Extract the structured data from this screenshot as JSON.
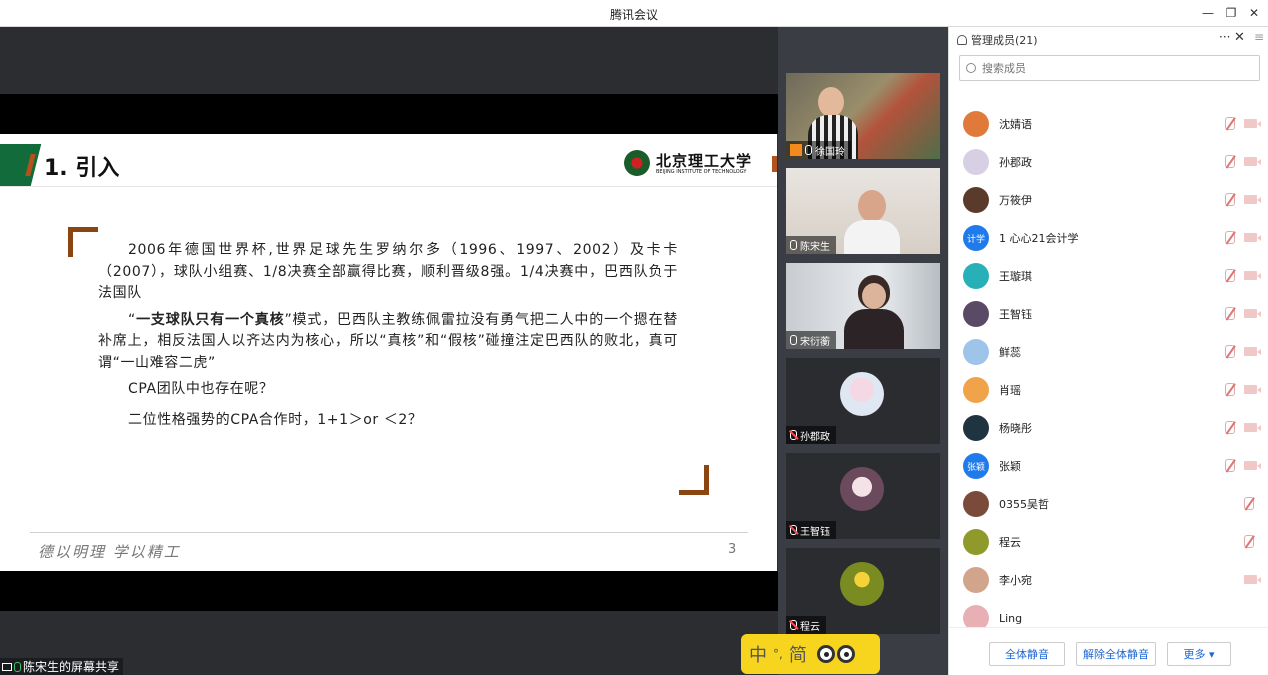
{
  "window": {
    "title": "腾讯会议"
  },
  "slide": {
    "heading": "1. 引入",
    "logo_cn": "北京理工大学",
    "logo_en": "BEIJING INSTITUTE OF TECHNOLOGY",
    "paragraph1": "2006年德国世界杯,世界足球先生罗纳尔多（1996、1997、2002）及卡卡（2007），球队小组赛、1/8决赛全部赢得比赛，顺利晋级8强。1/4决赛中，巴西队负于法国队",
    "paragraph2_pre": "“",
    "paragraph2_bold": "一支球队只有一个真核",
    "paragraph2_post": "”模式，巴西队主教练佩雷拉没有勇气把二人中的一个摁在替补席上，相反法国人以齐达内为核心，所以“真核”和“假核”碰撞注定巴西队的败北，真可谓“一山难容二虎”",
    "question1": "CPA团队中也存在呢？",
    "question2": "二位性格强势的CPA合作时，1+1＞or ＜2？",
    "motto": "德以明理 学以精工",
    "page_number": "3"
  },
  "sharer": {
    "label": "陈宋生的屏幕共享"
  },
  "video_tiles": [
    {
      "name": "徐国玲",
      "kind": "video",
      "mic": "on"
    },
    {
      "name": "陈宋生",
      "kind": "video",
      "mic": "on"
    },
    {
      "name": "宋衍蘅",
      "kind": "video",
      "mic": "on"
    },
    {
      "name": "孙郡政",
      "kind": "avatar",
      "mic": "muted"
    },
    {
      "name": "王智钰",
      "kind": "avatar",
      "mic": "muted"
    },
    {
      "name": "程云",
      "kind": "avatar",
      "mic": "muted"
    }
  ],
  "ime": {
    "mode1": "中",
    "sep": "°,",
    "mode2": "简"
  },
  "panel": {
    "title": "管理成员(21)",
    "more_icon": "ellipsis-icon",
    "search_placeholder": "搜索成员",
    "members": [
      {
        "name": "沈婧语",
        "avatar_color": "#e07a3b",
        "avatar_text": "",
        "mic": "off",
        "cam": "off"
      },
      {
        "name": "孙郡政",
        "avatar_color": "#d7cfe3",
        "avatar_text": "",
        "mic": "off",
        "cam": "off"
      },
      {
        "name": "万筱伊",
        "avatar_color": "#5a3a2a",
        "avatar_text": "",
        "mic": "off",
        "cam": "off"
      },
      {
        "name": "1 心心21会计学",
        "avatar_color": "#1f7aec",
        "avatar_text": "计学",
        "mic": "off",
        "cam": "off"
      },
      {
        "name": "王璇琪",
        "avatar_color": "#27b0b8",
        "avatar_text": "",
        "mic": "off",
        "cam": "off"
      },
      {
        "name": "王智钰",
        "avatar_color": "#5a4a66",
        "avatar_text": "",
        "mic": "off",
        "cam": "off"
      },
      {
        "name": "鲜蕊",
        "avatar_color": "#9fc4ea",
        "avatar_text": "",
        "mic": "off",
        "cam": "off"
      },
      {
        "name": "肖瑶",
        "avatar_color": "#f1a34a",
        "avatar_text": "",
        "mic": "off",
        "cam": "off"
      },
      {
        "name": "杨晓彤",
        "avatar_color": "#1f3340",
        "avatar_text": "",
        "mic": "off",
        "cam": "off"
      },
      {
        "name": "张颖",
        "avatar_color": "#1f7aec",
        "avatar_text": "张颖",
        "mic": "off",
        "cam": "off"
      },
      {
        "name": "0355吴哲",
        "avatar_color": "#7a4a3a",
        "avatar_text": "",
        "mic": "off",
        "cam": "none"
      },
      {
        "name": "程云",
        "avatar_color": "#8f9a2a",
        "avatar_text": "",
        "mic": "off",
        "cam": "none"
      },
      {
        "name": "李小宛",
        "avatar_color": "#d1a48b",
        "avatar_text": "",
        "mic": "none",
        "cam": "off"
      },
      {
        "name": "Ling",
        "avatar_color": "#e8b0b5",
        "avatar_text": "",
        "mic": "none",
        "cam": "none"
      }
    ],
    "buttons": {
      "mute_all": "全体静音",
      "unmute_all": "解除全体静音",
      "more": "更多 ▾"
    }
  }
}
